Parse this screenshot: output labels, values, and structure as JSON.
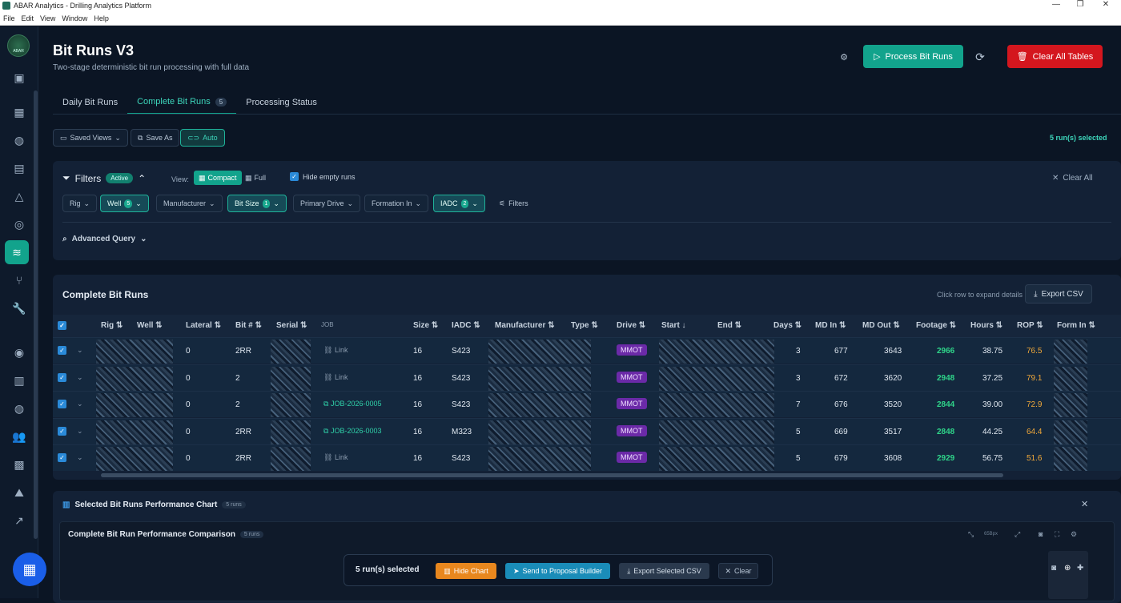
{
  "window": {
    "title": "ABAR Analytics - Drilling Analytics Platform",
    "menu": [
      "File",
      "Edit",
      "View",
      "Window",
      "Help"
    ]
  },
  "sidebar": {
    "logo_text": "ABAR"
  },
  "header": {
    "title": "Bit Runs V3",
    "subtitle": "Two-stage deterministic bit run processing with full data",
    "process_label": "Process Bit Runs",
    "clear_label": "Clear All Tables"
  },
  "tabs": [
    {
      "label": "Daily Bit Runs"
    },
    {
      "label": "Complete Bit Runs",
      "badge": "5"
    },
    {
      "label": "Processing Status"
    }
  ],
  "toolbar": {
    "saved_views": "Saved Views",
    "save_as": "Save As",
    "auto": "Auto",
    "selected_count": "5 run(s) selected"
  },
  "filters": {
    "title": "Filters",
    "active_badge": "Active",
    "view_label": "View:",
    "compact": "Compact",
    "full": "Full",
    "hide_empty": "Hide empty runs",
    "clear_all": "Clear All",
    "advanced": "Advanced Query",
    "chips": [
      {
        "label": "Rig",
        "count": ""
      },
      {
        "label": "Well",
        "count": "5"
      },
      {
        "label": "Manufacturer",
        "count": ""
      },
      {
        "label": "Bit Size",
        "count": "1"
      },
      {
        "label": "Primary Drive",
        "count": ""
      },
      {
        "label": "Formation In",
        "count": ""
      },
      {
        "label": "IADC",
        "count": "2"
      },
      {
        "label": "Filters",
        "count": ""
      }
    ]
  },
  "table": {
    "title": "Complete Bit Runs",
    "hint": "Click row to expand details",
    "export": "Export CSV",
    "columns": [
      "Rig ⇅",
      "Well ⇅",
      "Lateral ⇅",
      "Bit # ⇅",
      "Serial ⇅",
      "JOB",
      "Size ⇅",
      "IADC ⇅",
      "Manufacturer ⇅",
      "Type ⇅",
      "Drive ⇅",
      "Start ↓",
      "End ⇅",
      "Days ⇅",
      "MD In ⇅",
      "MD Out ⇅",
      "Footage ⇅",
      "Hours ⇅",
      "ROP ⇅",
      "Form In ⇅"
    ],
    "rows": [
      {
        "lateral": "0",
        "bit": "2RR",
        "job": "Link",
        "job_type": "link",
        "size": "16",
        "iadc": "S423",
        "drive": "MMOT",
        "days": "3",
        "md_in": "677",
        "md_out": "3643",
        "footage": "2966",
        "hours": "38.75",
        "rop": "76.5"
      },
      {
        "lateral": "0",
        "bit": "2",
        "job": "Link",
        "job_type": "link",
        "size": "16",
        "iadc": "S423",
        "drive": "MMOT",
        "days": "3",
        "md_in": "672",
        "md_out": "3620",
        "footage": "2948",
        "hours": "37.25",
        "rop": "79.1"
      },
      {
        "lateral": "0",
        "bit": "2",
        "job": "JOB-2026-0005",
        "job_type": "job",
        "size": "16",
        "iadc": "S423",
        "drive": "MMOT",
        "days": "7",
        "md_in": "676",
        "md_out": "3520",
        "footage": "2844",
        "hours": "39.00",
        "rop": "72.9"
      },
      {
        "lateral": "0",
        "bit": "2RR",
        "job": "JOB-2026-0003",
        "job_type": "job",
        "size": "16",
        "iadc": "M323",
        "drive": "MMOT",
        "days": "5",
        "md_in": "669",
        "md_out": "3517",
        "footage": "2848",
        "hours": "44.25",
        "rop": "64.4"
      },
      {
        "lateral": "0",
        "bit": "2RR",
        "job": "Link",
        "job_type": "link",
        "size": "16",
        "iadc": "S423",
        "drive": "MMOT",
        "days": "5",
        "md_in": "679",
        "md_out": "3608",
        "footage": "2929",
        "hours": "56.75",
        "rop": "51.6"
      }
    ]
  },
  "chart": {
    "title": "Selected Bit Runs Performance Chart",
    "runs_badge": "5 runs",
    "inner_title": "Complete Bit Run Performance Comparison",
    "inner_badge": "5 runs",
    "size_label": "65Bpx"
  },
  "actionbar": {
    "selected": "5 run(s) selected",
    "hide_chart": "Hide Chart",
    "send": "Send to Proposal Builder",
    "export_selected": "Export Selected CSV",
    "clear": "Clear"
  }
}
